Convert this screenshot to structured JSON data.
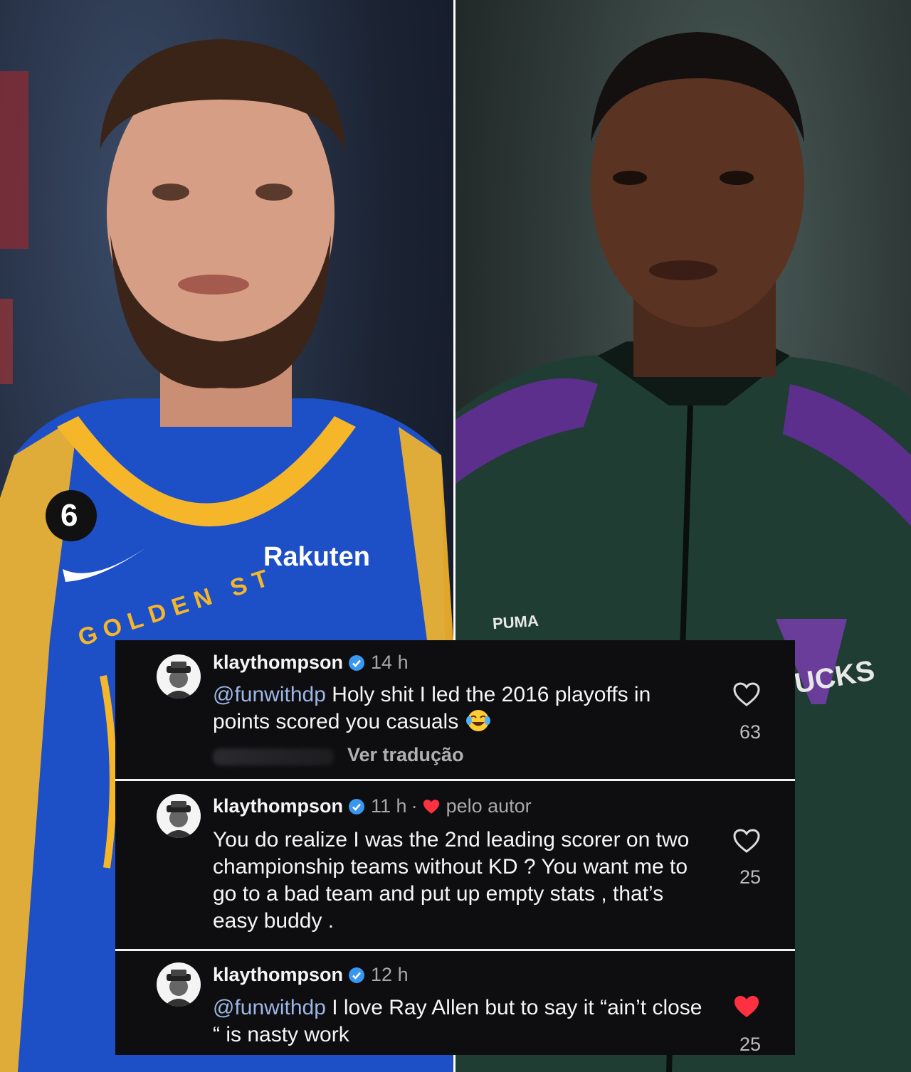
{
  "photos": {
    "left": {
      "jersey_number": "6",
      "sponsor": "Rakuten",
      "team_arc_text": "GOLDEN ST"
    },
    "right": {
      "brand": "PUMA",
      "team_text": "UCKS"
    }
  },
  "comments": [
    {
      "username": "klaythompson",
      "time": "14 h",
      "mention": "@funwithdp",
      "text": " Holy shit I led the 2016 playoffs in points scored you casuals",
      "emoji": "laughing-tears-emoji",
      "translate_label": "Ver tradução",
      "likes": "63",
      "liked": false
    },
    {
      "username": "klaythompson",
      "time": "11 h",
      "separator": "·",
      "author_label": "pelo autor",
      "text": "You do realize I was the 2nd leading scorer on two championship teams without KD ? You want me to go to a bad team and put up empty stats , that’s easy buddy .",
      "likes": "25",
      "liked": false
    },
    {
      "username": "klaythompson",
      "time": "12 h",
      "mention": "@funwithdp",
      "text": " I love Ray Allen but to say it “ain’t close “ is nasty work",
      "likes": "25",
      "liked": true
    }
  ],
  "colors": {
    "mention": "#9db6e6",
    "verified": "#3897f0",
    "liked_heart": "#ff3040",
    "panel_bg": "#0e0e10"
  }
}
